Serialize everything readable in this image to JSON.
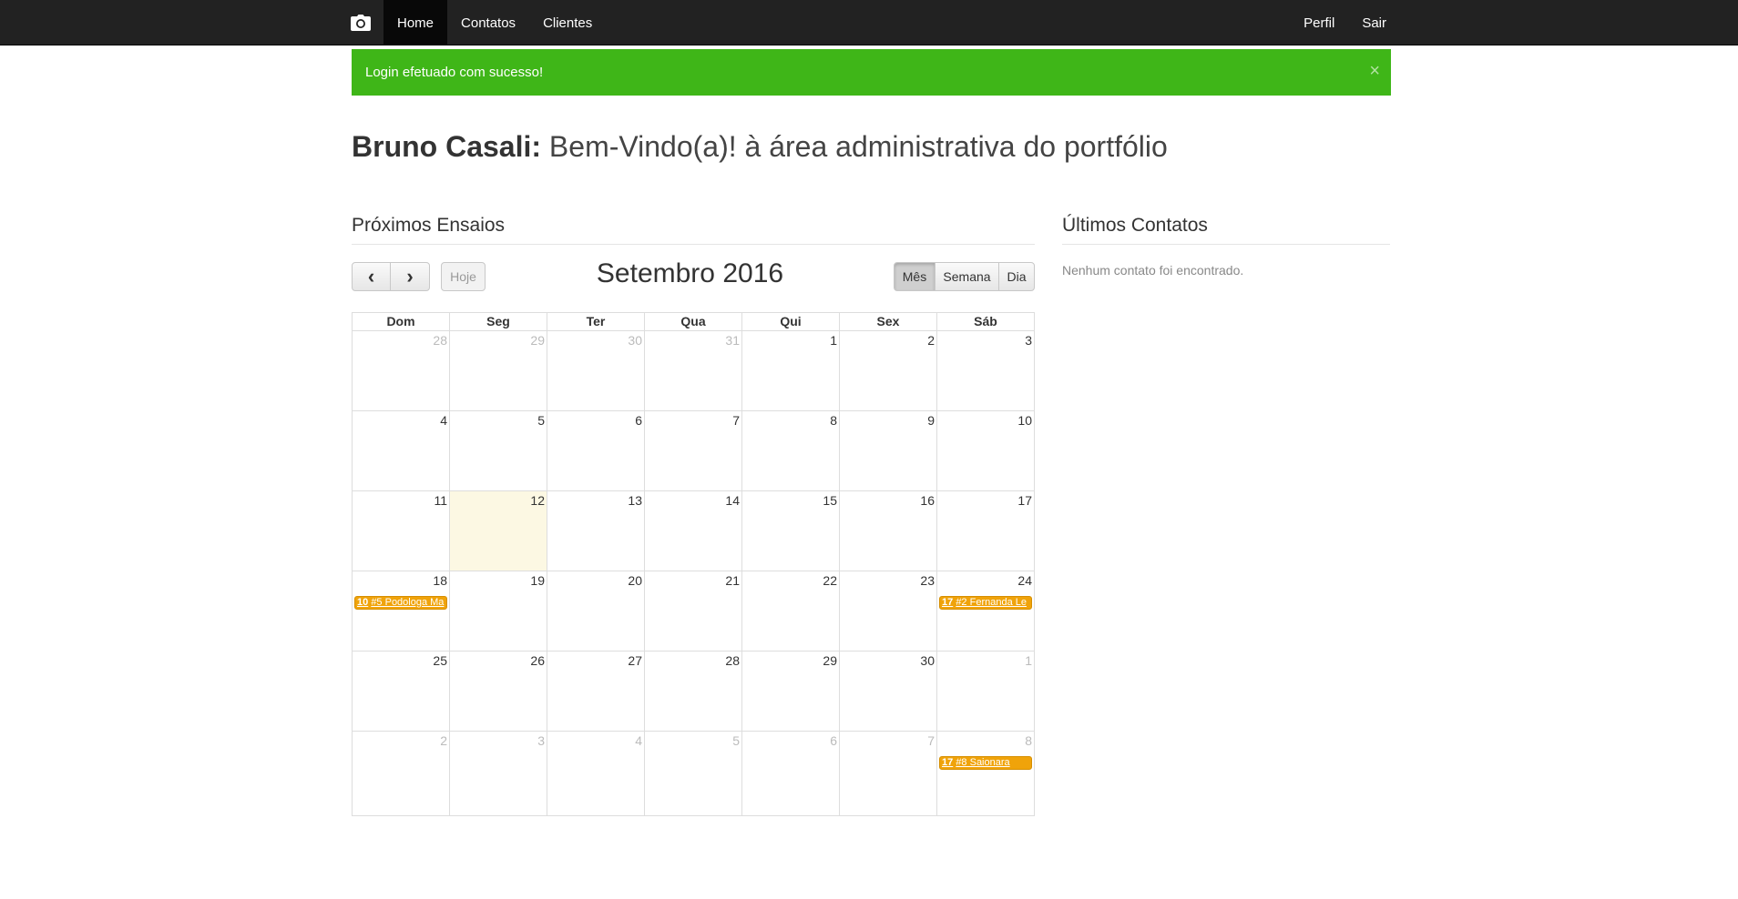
{
  "navbar": {
    "brand_icon": "camera-icon",
    "left_items": [
      {
        "label": "Home",
        "active": true
      },
      {
        "label": "Contatos",
        "active": false
      },
      {
        "label": "Clientes",
        "active": false
      }
    ],
    "right_items": [
      {
        "label": "Perfil"
      },
      {
        "label": "Sair"
      }
    ]
  },
  "alert": {
    "message": "Login efetuado com sucesso!",
    "close": "×",
    "color": "#3fb618"
  },
  "heading": {
    "name": "Bruno Casali:",
    "subtitle": "Bem-Vindo(a)! à área administrativa do portfólio"
  },
  "calendar": {
    "section_title": "Próximos Ensaios",
    "title": "Setembro 2016",
    "prev": "‹",
    "next": "›",
    "today": "Hoje",
    "views": [
      "Mês",
      "Semana",
      "Dia"
    ],
    "active_view": "Mês",
    "weekdays": [
      "Dom",
      "Seg",
      "Ter",
      "Qua",
      "Qui",
      "Sex",
      "Sáb"
    ],
    "weeks": [
      [
        "28",
        "29",
        "30",
        "31",
        "1",
        "2",
        "3"
      ],
      [
        "4",
        "5",
        "6",
        "7",
        "8",
        "9",
        "10"
      ],
      [
        "11",
        "12",
        "13",
        "14",
        "15",
        "16",
        "17"
      ],
      [
        "18",
        "19",
        "20",
        "21",
        "22",
        "23",
        "24"
      ],
      [
        "25",
        "26",
        "27",
        "28",
        "29",
        "30",
        "1"
      ],
      [
        "2",
        "3",
        "4",
        "5",
        "6",
        "7",
        "8"
      ]
    ],
    "today_date": "12",
    "event_color": "#f0a30a",
    "events": [
      {
        "time": "10",
        "title": "#5 Podologa Ma"
      },
      {
        "time": "17",
        "title": "#2 Fernanda Le"
      },
      {
        "time": "17",
        "title": "#8 Saionara"
      }
    ]
  },
  "contacts": {
    "section_title": "Últimos Contatos",
    "empty_message": "Nenhum contato foi encontrado."
  }
}
